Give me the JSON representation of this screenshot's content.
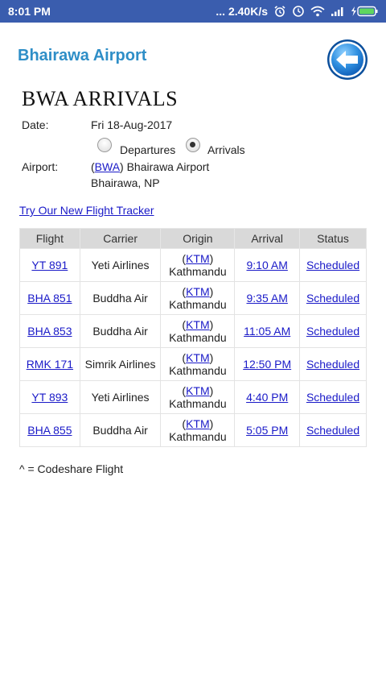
{
  "status_bar": {
    "time": "8:01 PM",
    "network_speed": "... 2.40K/s"
  },
  "header": {
    "app_title": "Bhairawa Airport"
  },
  "page": {
    "title": "BWA ARRIVALS",
    "date_label": "Date:",
    "date_value": "Fri 18-Aug-2017",
    "departures_label": "Departures",
    "arrivals_label": "Arrivals",
    "selected": "Arrivals",
    "airport_label": "Airport:",
    "airport_code": "BWA",
    "airport_paren_open": "(",
    "airport_name_suffix": ") Bhairawa Airport",
    "airport_city": "Bhairawa, NP",
    "tracker_link": "Try Our New Flight Tracker",
    "codeshare_note": "^ = Codeshare Flight"
  },
  "table": {
    "headers": {
      "flight": "Flight",
      "carrier": "Carrier",
      "origin": "Origin",
      "arrival": "Arrival",
      "status": "Status"
    },
    "rows": [
      {
        "flight": "YT 891",
        "carrier": "Yeti Airlines",
        "origin_code": "KTM",
        "origin_city": "Kathmandu",
        "arrival": "9:10 AM",
        "status": "Scheduled"
      },
      {
        "flight": "BHA 851",
        "carrier": "Buddha Air",
        "origin_code": "KTM",
        "origin_city": "Kathmandu",
        "arrival": "9:35 AM",
        "status": "Scheduled"
      },
      {
        "flight": "BHA 853",
        "carrier": "Buddha Air",
        "origin_code": "KTM",
        "origin_city": "Kathmandu",
        "arrival": "11:05 AM",
        "status": "Scheduled"
      },
      {
        "flight": "RMK 171",
        "carrier": "Simrik Airlines",
        "origin_code": "KTM",
        "origin_city": "Kathmandu",
        "arrival": "12:50 PM",
        "status": "Scheduled"
      },
      {
        "flight": "YT 893",
        "carrier": "Yeti Airlines",
        "origin_code": "KTM",
        "origin_city": "Kathmandu",
        "arrival": "4:40 PM",
        "status": "Scheduled"
      },
      {
        "flight": "BHA 855",
        "carrier": "Buddha Air",
        "origin_code": "KTM",
        "origin_city": "Kathmandu",
        "arrival": "5:05 PM",
        "status": "Scheduled"
      }
    ]
  },
  "colors": {
    "status_bar": "#3a5dae",
    "app_title": "#2e8ec7",
    "link": "#1a1ac8",
    "table_header": "#d9d9d9"
  },
  "icons": [
    "alarm-icon",
    "clock-icon",
    "wifi-icon",
    "signal-icon",
    "battery-charging-icon",
    "back-arrow-icon"
  ]
}
